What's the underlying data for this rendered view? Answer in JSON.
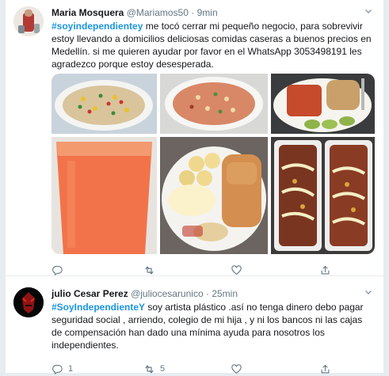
{
  "tweets": [
    {
      "name": "Maria Mosquera",
      "handle": "@Mariamos50",
      "time": "9min",
      "hashtag": "#soyindependientey",
      "text": " me tocó cerrar mi pequeño negocio, para sobrevivir estoy llevando a domicilios deliciosas comidas caseras a buenos precios en Medellín. si me quieren ayudar por favor en el WhatsApp 3053498191 les agradezco porque estoy desesperada.",
      "reply_count": "",
      "retweet_count": "",
      "like_count": ""
    },
    {
      "name": "julio Cesar Perez",
      "handle": "@juliocesarunico",
      "time": "25min",
      "hashtag": "#SoyIndependienteY",
      "text": " soy artista plástico .así no tenga dinero debo pagar seguridad social , arriendo, colegio de mi hija , y ni los bancos ni las cajas de compensación han dado una mínima ayuda para nosotros los independientes.",
      "reply_count": "1",
      "retweet_count": "5",
      "like_count": ""
    }
  ],
  "separator": "·",
  "icons": {
    "reply": "reply-icon",
    "retweet": "retweet-icon",
    "like": "heart-icon",
    "share": "share-icon",
    "caret": "chevron-down-icon"
  },
  "colors": {
    "hashtag": "#1b95e0",
    "secondary_text": "#657786",
    "divider": "#e6ecf0"
  }
}
